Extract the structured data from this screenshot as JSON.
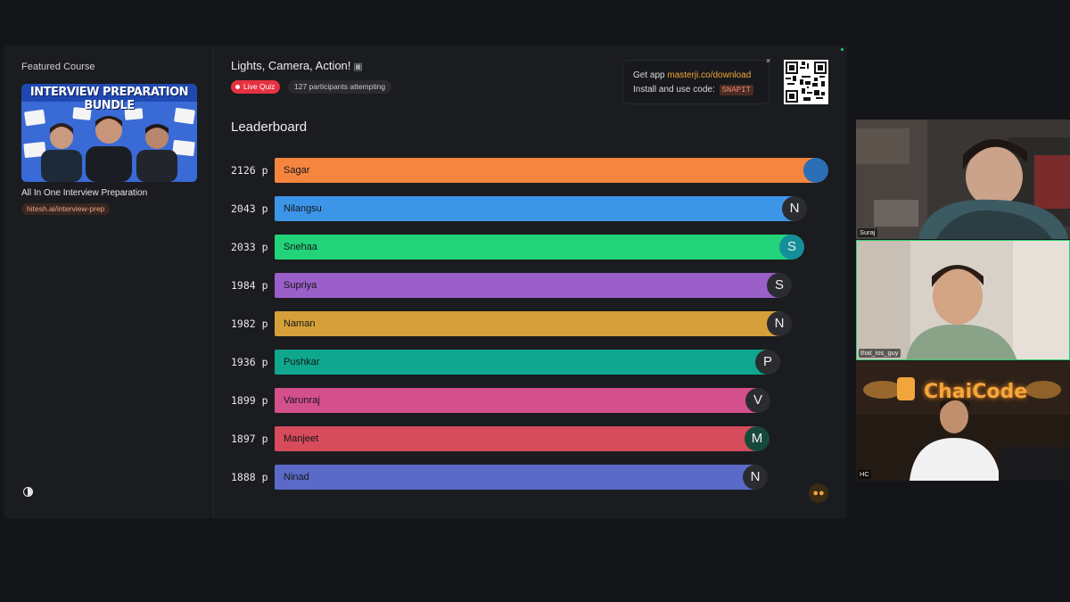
{
  "sidebar": {
    "featured_title": "Featured Course",
    "thumbnail_banner": "INTERVIEW PREPARATION BUNDLE",
    "thumbnail_tags": [
      "SYSTEM DESIGN",
      "DBMS",
      "DSA",
      "APTITUDE PREP",
      "COMPUTER NETWORK",
      "OPERATING SYSTEM"
    ],
    "course_name": "All In One Interview Preparation",
    "course_link": "hitesh.ai/interview-prep",
    "theme_toggle_icon": "contrast-icon"
  },
  "quiz": {
    "title": "Lights, Camera, Action!",
    "title_emoji": "clapperboard-icon",
    "live_label": "Live Quiz",
    "participants": "127 participants attempting"
  },
  "app_promo": {
    "prefix": "Get app ",
    "link": "masterji.co/download",
    "line2": "Install and use code:",
    "code": "SNAPIT",
    "close": "×"
  },
  "leaderboard": {
    "title": "Leaderboard",
    "rows": [
      {
        "score": "2126 p",
        "name": "Sagar",
        "avatar": "",
        "color": "#f5853f",
        "avatar_bg": "#2a6fb5",
        "relative": 1.0
      },
      {
        "score": "2043 p",
        "name": "Nilangsu",
        "avatar": "N",
        "color": "#3d95e8",
        "avatar_bg": "#2b2c30",
        "relative": 0.961
      },
      {
        "score": "2033 p",
        "name": "Snehaa",
        "avatar": "S",
        "color": "#22d37a",
        "avatar_bg": "#148f99",
        "relative": 0.956
      },
      {
        "score": "1984 p",
        "name": "Supriya",
        "avatar": "S",
        "color": "#9a5fc8",
        "avatar_bg": "#2b2c30",
        "relative": 0.933
      },
      {
        "score": "1982 p",
        "name": "Naman",
        "avatar": "N",
        "color": "#d5a03a",
        "avatar_bg": "#2b2c30",
        "relative": 0.932
      },
      {
        "score": "1936 p",
        "name": "Pushkar",
        "avatar": "P",
        "color": "#0fa88e",
        "avatar_bg": "#2b2c30",
        "relative": 0.911
      },
      {
        "score": "1899 p",
        "name": "Varunraj",
        "avatar": "V",
        "color": "#d4508c",
        "avatar_bg": "#2b2c30",
        "relative": 0.893
      },
      {
        "score": "1897 p",
        "name": "Manjeet",
        "avatar": "M",
        "color": "#d64c5a",
        "avatar_bg": "#16493a",
        "relative": 0.892
      },
      {
        "score": "1888 p",
        "name": "Ninad",
        "avatar": "N",
        "color": "#5b6ac8",
        "avatar_bg": "#2b2c30",
        "relative": 0.888
      }
    ]
  },
  "participants_video": [
    {
      "label": "Suraj"
    },
    {
      "label": "that_ios_guy"
    },
    {
      "label": "HC",
      "background_sign": "ChaiCode"
    }
  ],
  "icons": {
    "footer": "footsteps-icon"
  }
}
